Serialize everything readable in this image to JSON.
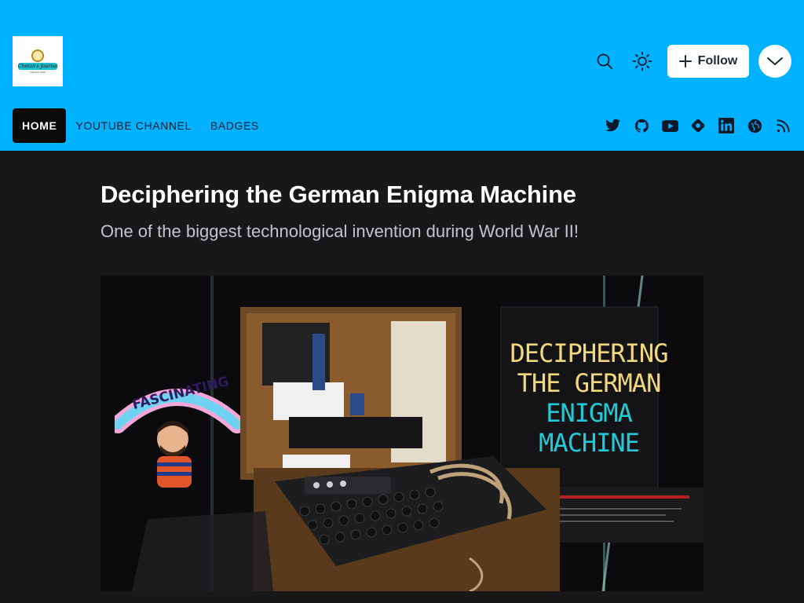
{
  "header": {
    "logo_text": "Chetan's Journal",
    "logo_sub": "CHETAN HIRE",
    "follow_label": "Follow"
  },
  "nav": {
    "items": [
      "HOME",
      "YOUTUBE CHANNEL",
      "BADGES"
    ]
  },
  "social": [
    "twitter-icon",
    "github-icon",
    "youtube-icon",
    "hashnode-icon",
    "linkedin-icon",
    "globe-icon",
    "rss-icon"
  ],
  "article": {
    "title": "Deciphering the German Enigma Machine",
    "subtitle": "One of the biggest technological invention during World War II!"
  },
  "cover": {
    "line1": "DECIPHERING",
    "line2": "THE GERMAN",
    "line3": "ENIGMA",
    "line4": "MACHINE",
    "sticker_text": "FASCINATING"
  },
  "colors": {
    "header_bg": "#00b2ff",
    "page_bg": "#18181b",
    "cover_yellow": "#f1d77e",
    "cover_cyan": "#24c9d8"
  }
}
